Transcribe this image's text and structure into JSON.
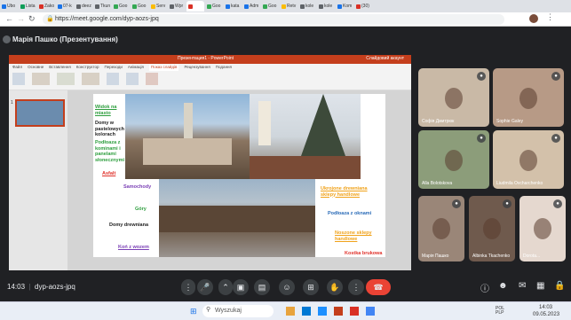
{
  "browser": {
    "tabs": [
      {
        "label": "Ubo",
        "color": "#1a73e8"
      },
      {
        "label": "Lista",
        "color": "#0f9d58"
      },
      {
        "label": "Zako",
        "color": "#d93025"
      },
      {
        "label": "07-k",
        "color": "#1a73e8"
      },
      {
        "label": "deez",
        "color": "#5f6368"
      },
      {
        "label": "Tkun",
        "color": "#5f6368"
      },
      {
        "label": "Goo",
        "color": "#34a853"
      },
      {
        "label": "Goo",
        "color": "#34a853"
      },
      {
        "label": "Serv",
        "color": "#fbbc04"
      },
      {
        "label": "Wpr",
        "color": "#5f6368"
      },
      {
        "label": "",
        "color": "#d93025"
      },
      {
        "label": "Goo",
        "color": "#34a853"
      },
      {
        "label": "kata",
        "color": "#1a73e8"
      },
      {
        "label": "Adm",
        "color": "#1a73e8"
      },
      {
        "label": "Goo",
        "color": "#34a853"
      },
      {
        "label": "Retv",
        "color": "#fbbc04"
      },
      {
        "label": "kole",
        "color": "#5f6368"
      },
      {
        "label": "kole",
        "color": "#5f6368"
      },
      {
        "label": "Kom",
        "color": "#1a73e8"
      },
      {
        "label": "(30)",
        "color": "#d93025"
      }
    ],
    "url": "https://meet.google.com/dyp-aozs-jpq"
  },
  "meet": {
    "presenter": "Марія Пашко (Презентування)",
    "meeting_code": "14:03 | dyp-aozs-jpq",
    "time": "14:03",
    "code": "dyp-aozs-jpq"
  },
  "ppt": {
    "title_bar": "Презентация1 - PowerPoint",
    "tabs": [
      "Файл",
      "Основне",
      "Вставлення",
      "Конструктор",
      "Переходи",
      "Анімація",
      "Показ слайдів",
      "Рецензування",
      "Подання"
    ],
    "active_tab": "Показ слайдів",
    "user": "Слайдовий акаунт"
  },
  "slide": {
    "labels": [
      {
        "text": "Widok na miasto",
        "color": "#2e9e3e"
      },
      {
        "text": "Domy w pastelowych kolorach",
        "color": "#222222"
      },
      {
        "text": "Podłoaza z kominami i panelami słonecznymi",
        "color": "#2e9e3e"
      },
      {
        "text": "Asfalt",
        "color": "#e0322b"
      },
      {
        "text": "Samochody",
        "color": "#7a3fb5"
      },
      {
        "text": "Góry",
        "color": "#2e9e3e"
      },
      {
        "text": "Domy drewniana",
        "color": "#222222"
      },
      {
        "text": "Koń z wozem",
        "color": "#7a3fb5"
      },
      {
        "text": "Ukrojone drewniana sklepy handlowe",
        "color": "#f0a21a"
      },
      {
        "text": "Podłoaza z oknami",
        "color": "#2b6cb8"
      },
      {
        "text": "Noszone sklepy handlowe",
        "color": "#f0a21a"
      },
      {
        "text": "Kostka brukowa",
        "color": "#e0322b"
      }
    ]
  },
  "participants": [
    {
      "name": "Софія Дмитрюк",
      "bg": "#c9b9a6"
    },
    {
      "name": "Sophie Galey",
      "bg": "#b79a86"
    },
    {
      "name": "Alla Bolotskova",
      "bg": "#8c9d7a"
    },
    {
      "name": "Liudmila Ovcharchenko",
      "bg": "#d3c1aa"
    },
    {
      "name": "Марія Пашко",
      "bg": "#9a8678"
    },
    {
      "name": "Albinka Tkachenko",
      "bg": "#6f5a4d"
    },
    {
      "name": "Dorota...",
      "bg": "#e5d8cf"
    }
  ],
  "albinka_initial": "A",
  "albinka_label": "Albinka Tkach...",
  "taskbar": {
    "search": "Wyszukaj",
    "lang": "POL PLP",
    "time": "14:03",
    "date": "09.05.2023"
  }
}
